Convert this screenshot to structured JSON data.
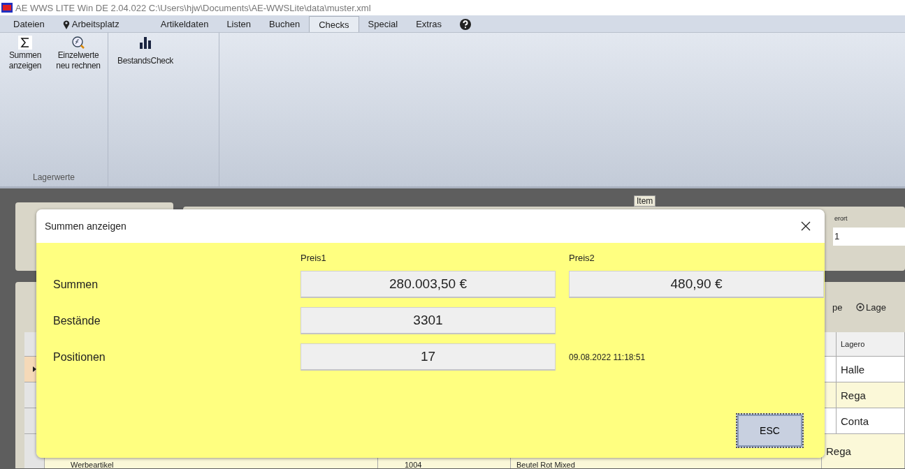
{
  "window": {
    "title": "AE WWS LITE Win DE 2.04.022 C:\\Users\\hjw\\Documents\\AE-WWSLite\\data\\muster.xml"
  },
  "tabs": [
    {
      "label": "Dateien",
      "selected": false
    },
    {
      "label": "Arbeitsplatz",
      "selected": false,
      "kind": "pin"
    },
    {
      "label": "Artikeldaten",
      "selected": false
    },
    {
      "label": "Listen",
      "selected": false
    },
    {
      "label": "Buchen",
      "selected": false
    },
    {
      "label": "Checks",
      "selected": true
    },
    {
      "label": "Special",
      "selected": false
    },
    {
      "label": "Extras",
      "selected": false
    },
    {
      "selected": false,
      "kind": "help"
    }
  ],
  "ribbon": {
    "groups": [
      {
        "label": "Lagerwerte",
        "buttons": [
          {
            "label": "Summen\nanzeigen",
            "kind": "sum"
          },
          {
            "label": "Einzelwerte\nneu rechnen",
            "kind": "formula"
          }
        ]
      },
      {
        "buttons": [
          {
            "label": "BestandsCheck",
            "kind": "chart"
          }
        ]
      }
    ]
  },
  "background": {
    "group_label": "Item",
    "field_label": "erort",
    "field_value": "1",
    "toolbar": [
      {
        "label": "pe"
      },
      {
        "label": "Lage",
        "kind": "icon"
      }
    ],
    "grid": {
      "header": "Lagero",
      "rows": [
        {
          "selected": true,
          "cells": [
            "",
            "",
            "",
            "Halle"
          ]
        },
        {
          "selected": false,
          "cells": [
            "",
            "",
            "",
            "Rega"
          ]
        },
        {
          "selected": false,
          "cells": [
            "",
            "",
            "",
            "Conta"
          ]
        },
        {
          "selected": false,
          "cells": [
            "Werbeartikel",
            "1004",
            "Beutel Rot Mixed",
            "Rega"
          ]
        }
      ]
    }
  },
  "dialog": {
    "title": "Summen anzeigen",
    "columns": [
      "Preis1",
      "Preis2"
    ],
    "rows": [
      {
        "label": "Summen",
        "values": [
          "280.003,50 €",
          "480,90 €"
        ]
      },
      {
        "label": "Bestände",
        "values": [
          "3301"
        ]
      },
      {
        "label": "Positionen",
        "values": [
          "17"
        ],
        "note": "09.08.2022 11:18:51"
      }
    ],
    "button": "ESC"
  }
}
